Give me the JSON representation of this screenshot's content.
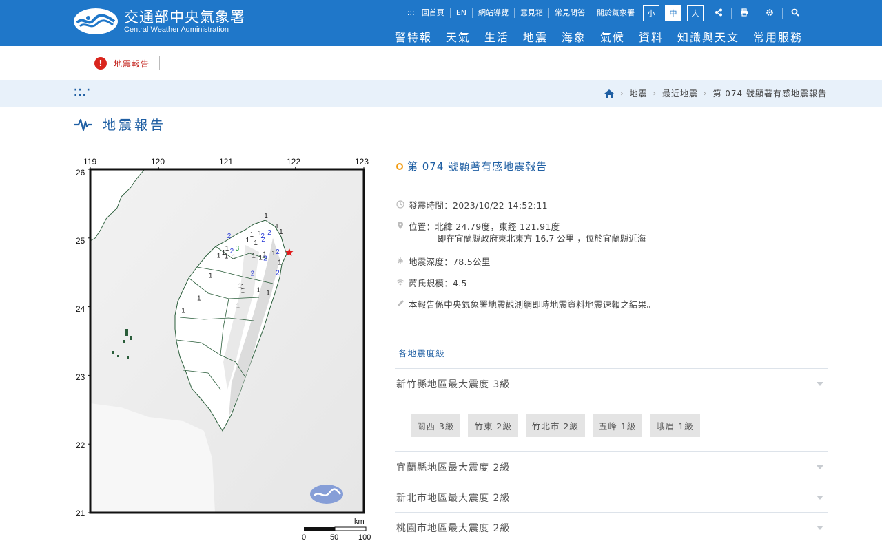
{
  "header": {
    "logo_zh": "交通部中央氣象署",
    "logo_en": "Central Weather Administration",
    "top_links": [
      "回首頁",
      "EN",
      "網站導覽",
      "意見箱",
      "常見問答",
      "關於氣象署"
    ],
    "sizes": [
      "小",
      "中",
      "大"
    ],
    "active_size": "中",
    "main_nav": [
      "警特報",
      "天氣",
      "生活",
      "地震",
      "海象",
      "氣候",
      "資料",
      "知識與天文",
      "常用服務"
    ]
  },
  "alert": {
    "label": "地震報告"
  },
  "breadcrumb": [
    "地震",
    "最近地震",
    "第 074 號顯著有感地震報告"
  ],
  "page_title": "地震報告",
  "map": {
    "lon_ticks": [
      "119",
      "120",
      "121",
      "122",
      "123"
    ],
    "lat_ticks": [
      "26",
      "25",
      "24",
      "23",
      "22",
      "21"
    ],
    "scale_unit": "km",
    "scale_labels": [
      "0",
      "50",
      "100"
    ],
    "intensity_marks": [
      {
        "v": "1",
        "lon": 121.57,
        "lat": 25.29
      },
      {
        "v": "1",
        "lon": 121.73,
        "lat": 25.14
      },
      {
        "v": "2",
        "lon": 121.62,
        "lat": 25.05
      },
      {
        "v": "1",
        "lon": 121.79,
        "lat": 25.06
      },
      {
        "v": "1",
        "lon": 121.48,
        "lat": 25.04
      },
      {
        "v": "2",
        "lon": 121.52,
        "lat": 25.0
      },
      {
        "v": "2",
        "lon": 121.53,
        "lat": 24.95
      },
      {
        "v": "1",
        "lon": 121.36,
        "lat": 25.02
      },
      {
        "v": "1",
        "lon": 121.3,
        "lat": 24.94
      },
      {
        "v": "1",
        "lon": 121.42,
        "lat": 24.9
      },
      {
        "v": "2",
        "lon": 121.03,
        "lat": 25.0
      },
      {
        "v": "1",
        "lon": 121.0,
        "lat": 24.82
      },
      {
        "v": "3",
        "lon": 121.15,
        "lat": 24.82
      },
      {
        "v": "2",
        "lon": 121.07,
        "lat": 24.78
      },
      {
        "v": "1",
        "lon": 120.95,
        "lat": 24.76
      },
      {
        "v": "1",
        "lon": 120.88,
        "lat": 24.71
      },
      {
        "v": "1",
        "lon": 120.99,
        "lat": 24.7
      },
      {
        "v": "1",
        "lon": 121.1,
        "lat": 24.69
      },
      {
        "v": "1",
        "lon": 121.55,
        "lat": 24.73
      },
      {
        "v": "2",
        "lon": 121.56,
        "lat": 24.67
      },
      {
        "v": "1",
        "lon": 121.49,
        "lat": 24.68
      },
      {
        "v": "1",
        "lon": 121.39,
        "lat": 24.71
      },
      {
        "v": "2",
        "lon": 121.74,
        "lat": 24.77
      },
      {
        "v": "1",
        "lon": 121.68,
        "lat": 24.75
      },
      {
        "v": "1",
        "lon": 121.77,
        "lat": 24.61
      },
      {
        "v": "2",
        "lon": 121.37,
        "lat": 24.45
      },
      {
        "v": "2",
        "lon": 121.74,
        "lat": 24.46
      },
      {
        "v": "1",
        "lon": 120.76,
        "lat": 24.42
      },
      {
        "v": "1",
        "lon": 121.19,
        "lat": 24.27
      },
      {
        "v": "1",
        "lon": 121.23,
        "lat": 24.26
      },
      {
        "v": "1",
        "lon": 121.46,
        "lat": 24.21
      },
      {
        "v": "1",
        "lon": 121.6,
        "lat": 24.17
      },
      {
        "v": "1",
        "lon": 121.23,
        "lat": 24.2
      },
      {
        "v": "1",
        "lon": 120.59,
        "lat": 24.09
      },
      {
        "v": "1",
        "lon": 121.16,
        "lat": 23.98
      },
      {
        "v": "1",
        "lon": 120.36,
        "lat": 23.91
      }
    ],
    "epicenter": {
      "lon": 121.91,
      "lat": 24.79
    }
  },
  "report": {
    "title": "第 074 號顯著有感地震報告",
    "time": "發震時間：2023/10/22 14:52:11",
    "location": "位置：北緯 24.79度，東經 121.91度",
    "location_detail": "即在宜蘭縣政府東北東方 16.7 公里 ，位於宜蘭縣近海",
    "depth": "地震深度：78.5公里",
    "magnitude": "芮氏規模：4.5",
    "note": "本報告係中央氣象署地震觀測網即時地震資料地震速報之結果。",
    "subhead": "各地震度級",
    "areas": [
      {
        "label": "新竹縣地區最大震度 3級"
      },
      {
        "label": "宜蘭縣地區最大震度 2級"
      },
      {
        "label": "新北市地區最大震度 2級"
      },
      {
        "label": "桃園市地區最大震度 2級"
      }
    ],
    "stations": [
      "關西 3級",
      "竹東 2級",
      "竹北市 2級",
      "五峰 1級",
      "峨眉 1級"
    ]
  },
  "colors": {
    "brand": "#1f77c9",
    "accent": "#f39c12",
    "alert": "#d9251d"
  }
}
